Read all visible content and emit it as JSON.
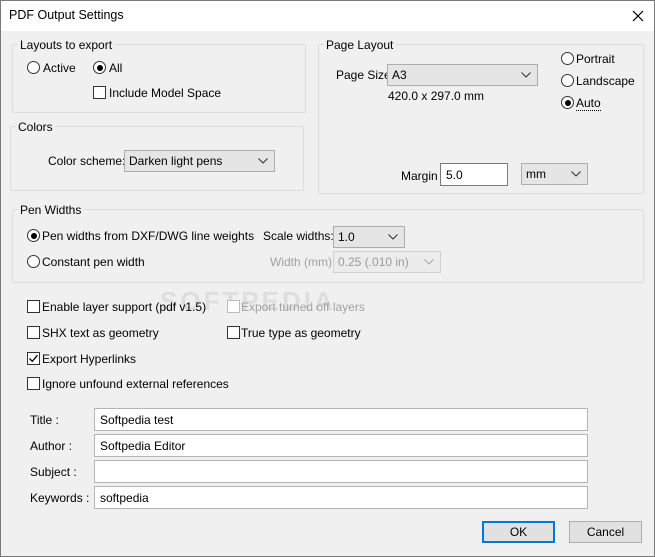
{
  "window": {
    "title": "PDF Output Settings"
  },
  "layouts": {
    "legend": "Layouts to export",
    "active_label": "Active",
    "all_label": "All",
    "selected": "All",
    "include_model_space_label": "Include Model Space",
    "include_model_space_checked": false
  },
  "colors": {
    "legend": "Colors",
    "scheme_label": "Color scheme:",
    "scheme_value": "Darken light pens"
  },
  "page_layout": {
    "legend": "Page Layout",
    "page_size_label": "Page Size",
    "page_size_value": "A3",
    "dimensions": "420.0 x 297.0 mm",
    "portrait_label": "Portrait",
    "landscape_label": "Landscape",
    "auto_label": "Auto",
    "orientation_selected": "Auto",
    "margin_label": "Margin",
    "margin_value": "5.0",
    "margin_unit": "mm"
  },
  "pen_widths": {
    "legend": "Pen Widths",
    "from_dxf_label": "Pen widths from DXF/DWG line weights",
    "constant_label": "Constant pen width",
    "selected": "from_dxf",
    "scale_label": "Scale widths:",
    "scale_value": "1.0",
    "width_label": "Width (mm):",
    "width_value": "0.25  (.010 in)"
  },
  "options": {
    "enable_layer_support_label": "Enable layer support (pdf v1.5)",
    "enable_layer_support_checked": false,
    "export_turned_off_label": "Export turned off layers",
    "export_turned_off_checked": false,
    "shx_label": "SHX text as geometry",
    "shx_checked": false,
    "true_type_label": "True type as geometry",
    "true_type_checked": false,
    "export_hyperlinks_label": "Export Hyperlinks",
    "export_hyperlinks_checked": true,
    "ignore_refs_label": "Ignore unfound external references",
    "ignore_refs_checked": false
  },
  "metadata": {
    "title_label": "Title :",
    "title_value": "Softpedia test",
    "author_label": "Author :",
    "author_value": "Softpedia Editor",
    "subject_label": "Subject :",
    "subject_value": "",
    "keywords_label": "Keywords :",
    "keywords_value": "softpedia"
  },
  "buttons": {
    "ok_label": "OK",
    "cancel_label": "Cancel"
  },
  "watermark": "SOFTPEDIA",
  "colors_theme": {
    "accent": "#0078d7",
    "dialog_bg": "#f0f0f0"
  }
}
